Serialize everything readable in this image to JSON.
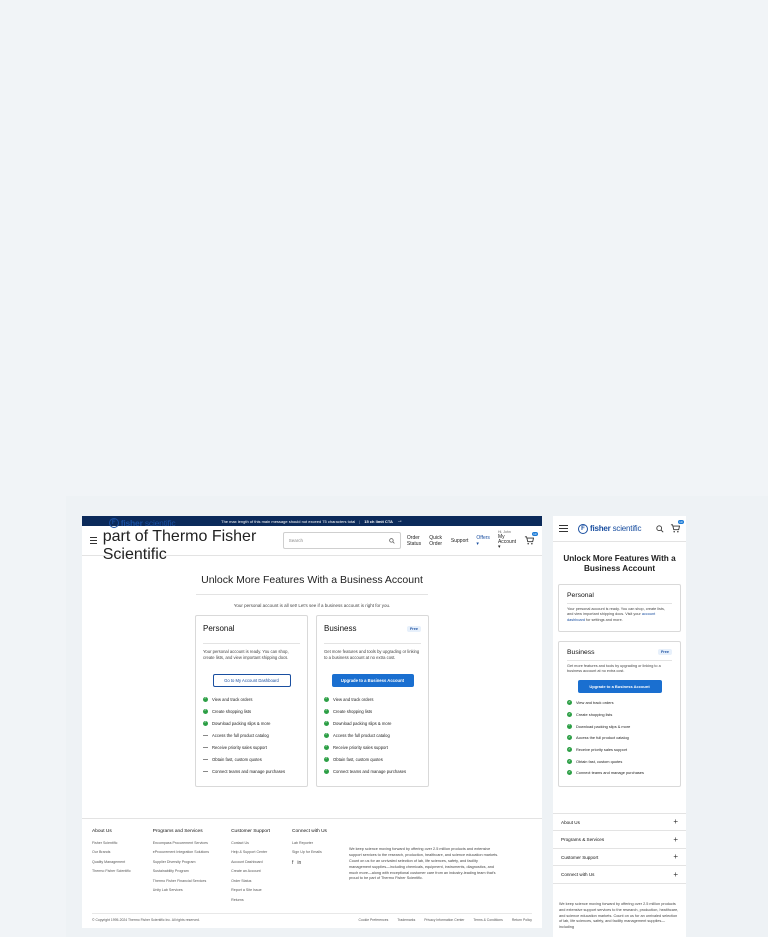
{
  "promo": {
    "message": "The max length of this main message should not exceed 75 characters total",
    "sep": "|",
    "cta": "15 ch limit CTA",
    "arrow": "→"
  },
  "header": {
    "logo_mark": "F",
    "logo_bold": "fisher",
    "logo_rest": " scientific",
    "logo_sub": "part of Thermo Fisher Scientific",
    "search_placeholder": "Search",
    "nav": [
      "Order Status",
      "Quick Order",
      "Support",
      "Offers ▾"
    ],
    "account_hi": "Hi, John",
    "account_label": "My Account ▾",
    "cart_count": "10"
  },
  "main": {
    "title": "Unlock More Features With a Business Account",
    "lead": "Your personal account is all set! Let's see if a business account is right for you."
  },
  "personal": {
    "title": "Personal",
    "desc": "Your personal account is ready. You can shop, create lists, and view important shipping docs.",
    "button": "Go to My Account Dashboard",
    "features": [
      {
        "label": "View and track orders",
        "on": true
      },
      {
        "label": "Create shopping lists",
        "on": true
      },
      {
        "label": "Download packing slips & more",
        "on": true
      },
      {
        "label": "Access the full product catalog",
        "on": false
      },
      {
        "label": "Receive priority sales support",
        "on": false
      },
      {
        "label": "Obtain fast, custom quotes",
        "on": false
      },
      {
        "label": "Connect teams and manage purchases",
        "on": false
      }
    ]
  },
  "business": {
    "title": "Business",
    "badge": "Free",
    "desc": "Get more features and tools by upgrading or linking to a business account at no extra cost.",
    "button": "Upgrade to a Business Account",
    "features": [
      "View and track orders",
      "Create shopping lists",
      "Download packing slips & more",
      "Access the full product catalog",
      "Receive priority sales support",
      "Obtain fast, custom quotes",
      "Connect teams and manage purchases"
    ]
  },
  "footer": {
    "cols": [
      {
        "title": "About Us",
        "links": [
          "Fisher Scientific",
          "Our Brands",
          "Quality Management",
          "Thermo Fisher Scientific"
        ]
      },
      {
        "title": "Programs and Services",
        "links": [
          "Encompass Procurement Services",
          "eProcurement Integration Solutions",
          "Supplier Diversity Program",
          "Sustainability Program",
          "Thermo Fisher Financial Services",
          "Unity Lab Services"
        ]
      },
      {
        "title": "Customer Support",
        "links": [
          "Contact Us",
          "Help & Support Center",
          "Account Dashboard",
          "Create an Account",
          "Order Status",
          "Report a Site Issue",
          "Returns"
        ]
      },
      {
        "title": "Connect with Us",
        "links": [
          "Lab Reporter",
          "Sign Up for Emails"
        ]
      }
    ],
    "social": [
      "f",
      "in"
    ],
    "blurb": "We keep science moving forward by offering over 2.5 million products and extensive support services to the research, production, healthcare, and science education markets. Count on us for an unrivaled selection of lab, life sciences, safety, and facility management supplies—including chemicals, equipment, instruments, diagnostics, and much more—along with exceptional customer care from an industry-leading team that's proud to be part of Thermo Fisher Scientific.",
    "copyright": "© Copyright 1995-2024 Thermo Fisher Scientific Inc. All rights reserved.",
    "legal": [
      "Cookie Preferences",
      "Trademarks",
      "Privacy Information Center",
      "Terms & Conditions",
      "Return Policy"
    ]
  },
  "mobile": {
    "title": "Unlock More Features With a Business Account",
    "personal_title": "Personal",
    "personal_desc_a": "Your personal account is ready. You can shop, create lists, and view important shipping docs. Visit your ",
    "personal_link": "account dashboard",
    "personal_desc_b": " for settings and more.",
    "business_title": "Business",
    "badge": "Free",
    "business_desc": "Get more features and tools by upgrading or linking to a business account at no extra cost.",
    "button": "Upgrade to a Business Account",
    "features": [
      "View and track orders",
      "Create shopping lists",
      "Download packing slips & more",
      "Access the full product catalog",
      "Receive priority sales support",
      "Obtain fast, custom quotes",
      "Connect teams and manage purchases"
    ],
    "accordion": [
      "About Us",
      "Programs & Services",
      "Customer Support",
      "Connect with Us"
    ],
    "blurb": "We keep science moving forward by offering over 2.5 million products and extensive support services to the research, production, healthcare, and science education markets. Count on us for an unrivaled selection of lab, life sciences, safety, and facility management supplies—including"
  },
  "icons": {
    "menu": "hamburger-icon",
    "search": "search-icon",
    "cart": "cart-icon",
    "check": "check-icon",
    "dash": "dash-icon",
    "plus": "plus-icon"
  },
  "colors": {
    "brand": "#1a4fa0",
    "button": "#1a6fd0",
    "promo_bg": "#0b2a5a",
    "check": "#2c9f45"
  }
}
